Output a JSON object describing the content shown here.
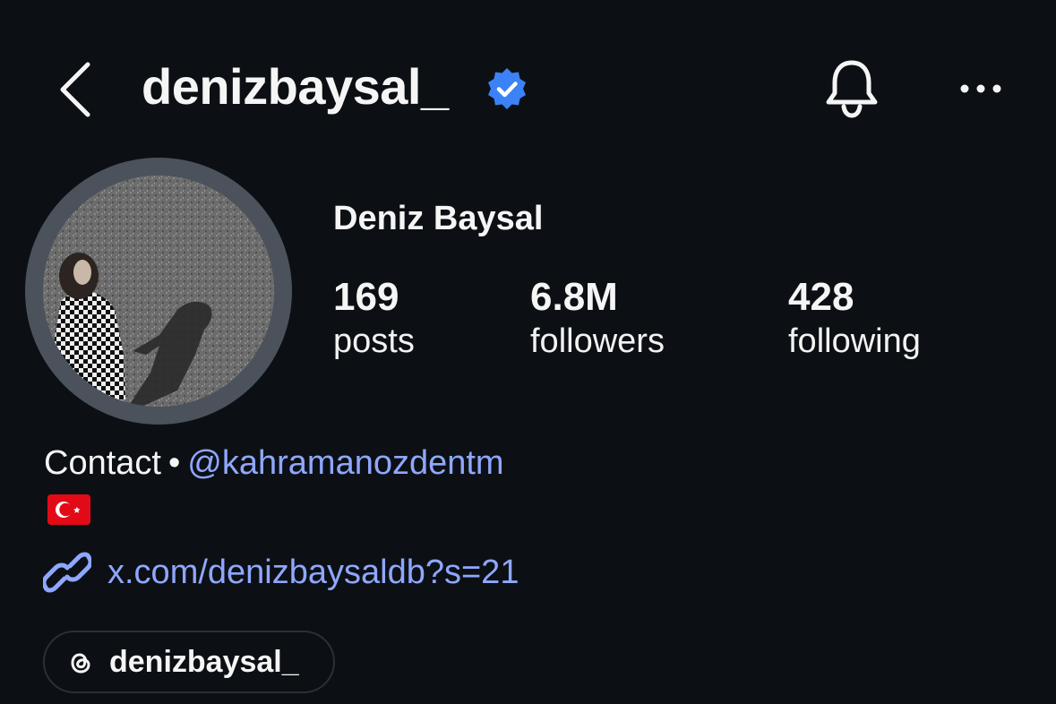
{
  "header": {
    "username": "denizbaysal_",
    "verified": true,
    "icons": [
      "back-arrow-icon",
      "verified-badge-icon",
      "bell-icon",
      "more-icon"
    ]
  },
  "profile": {
    "full_name": "Deniz Baysal",
    "stats": {
      "posts": {
        "value": "169",
        "label": "posts"
      },
      "followers": {
        "value": "6.8M",
        "label": "followers"
      },
      "following": {
        "value": "428",
        "label": "following"
      }
    }
  },
  "bio": {
    "contact_label": "Contact",
    "separator": "•",
    "mention": "@kahramanozdentm",
    "flag": "turkey-flag",
    "link": "x.com/denizbaysaldb?s=21"
  },
  "threads": {
    "handle": "denizbaysal_"
  },
  "colors": {
    "background": "#0c1014",
    "text": "#f5f5f5",
    "link": "#8fa7ff",
    "verified": "#3b82f6",
    "avatar_ring": "#4b525b"
  }
}
